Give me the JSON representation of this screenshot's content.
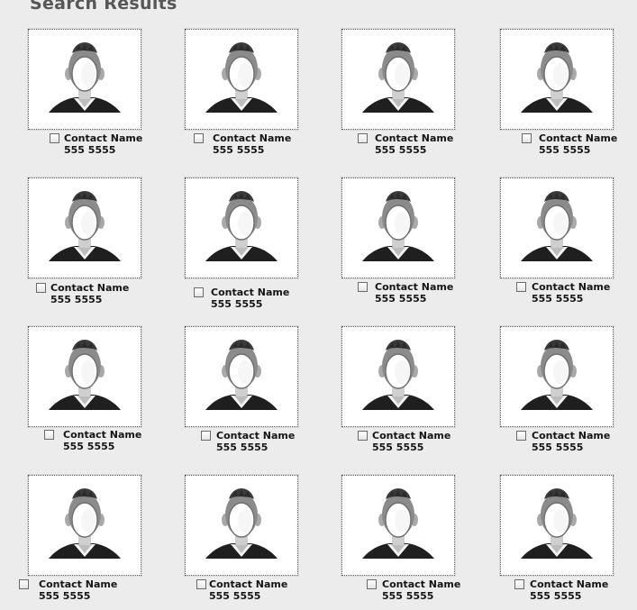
{
  "page": {
    "title": "Search Results"
  },
  "results": [
    {
      "name": "Contact Name",
      "phone": "555 5555",
      "checked": false
    },
    {
      "name": "Contact Name",
      "phone": "555 5555",
      "checked": false
    },
    {
      "name": "Contact Name",
      "phone": "555 5555",
      "checked": false
    },
    {
      "name": "Contact Name",
      "phone": "555 5555",
      "checked": false
    },
    {
      "name": "Contact Name",
      "phone": "555 5555",
      "checked": false
    },
    {
      "name": "Contact Name",
      "phone": "555 5555",
      "checked": false
    },
    {
      "name": "Contact Name",
      "phone": "555 5555",
      "checked": false
    },
    {
      "name": "Contact Name",
      "phone": "555 5555",
      "checked": false
    },
    {
      "name": "Contact Name",
      "phone": "555 5555",
      "checked": false
    },
    {
      "name": "Contact Name",
      "phone": "555 5555",
      "checked": false
    },
    {
      "name": "Contact Name",
      "phone": "555 5555",
      "checked": false
    },
    {
      "name": "Contact Name",
      "phone": "555 5555",
      "checked": false
    },
    {
      "name": "Contact Name",
      "phone": "555 5555",
      "checked": false
    },
    {
      "name": "Contact Name",
      "phone": "555 5555",
      "checked": false
    },
    {
      "name": "Contact Name",
      "phone": "555 5555",
      "checked": false
    },
    {
      "name": "Contact Name",
      "phone": "555 5555",
      "checked": false
    }
  ],
  "photo_placeholder": {
    "icon": "person-silhouette-icon"
  }
}
